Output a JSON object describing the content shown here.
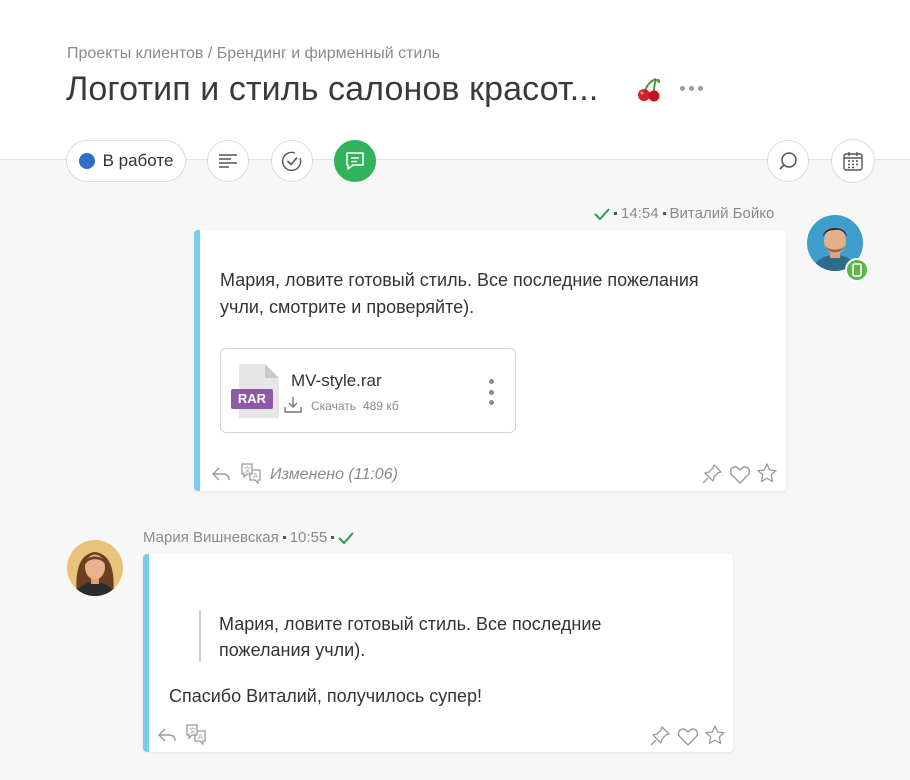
{
  "header": {
    "breadcrumb": "Проекты клиентов / Брендинг и фирменный стиль",
    "title": "Логотип и стиль салонов красот..."
  },
  "toolbar": {
    "status_label": "В работе",
    "status_color": "#2f6fc9",
    "accent_color": "#33b25a",
    "icons": [
      "description-lines-icon",
      "checklist-icon",
      "chat-icon",
      "search-icon",
      "calendar-icon"
    ]
  },
  "messages": [
    {
      "time": "14:54",
      "author": "Виталий Бойко",
      "text_line1": "Мария, ловите готовый стиль. Все последние пожелания",
      "text_line2": "учли, смотрите и проверяйте).",
      "attachment": {
        "type_label": "RAR",
        "name": "MV-style.rar",
        "download_label": "Скачать",
        "size": "489 кб"
      },
      "edited": "Изменено (11:06)"
    },
    {
      "author": "Мария Вишневская",
      "time": "10:55",
      "quote_line1": "Мария, ловите готовый стиль. Все последние",
      "quote_line2": "пожелания учли).",
      "text": "Спасибо Виталий, получилось супер!"
    }
  ]
}
